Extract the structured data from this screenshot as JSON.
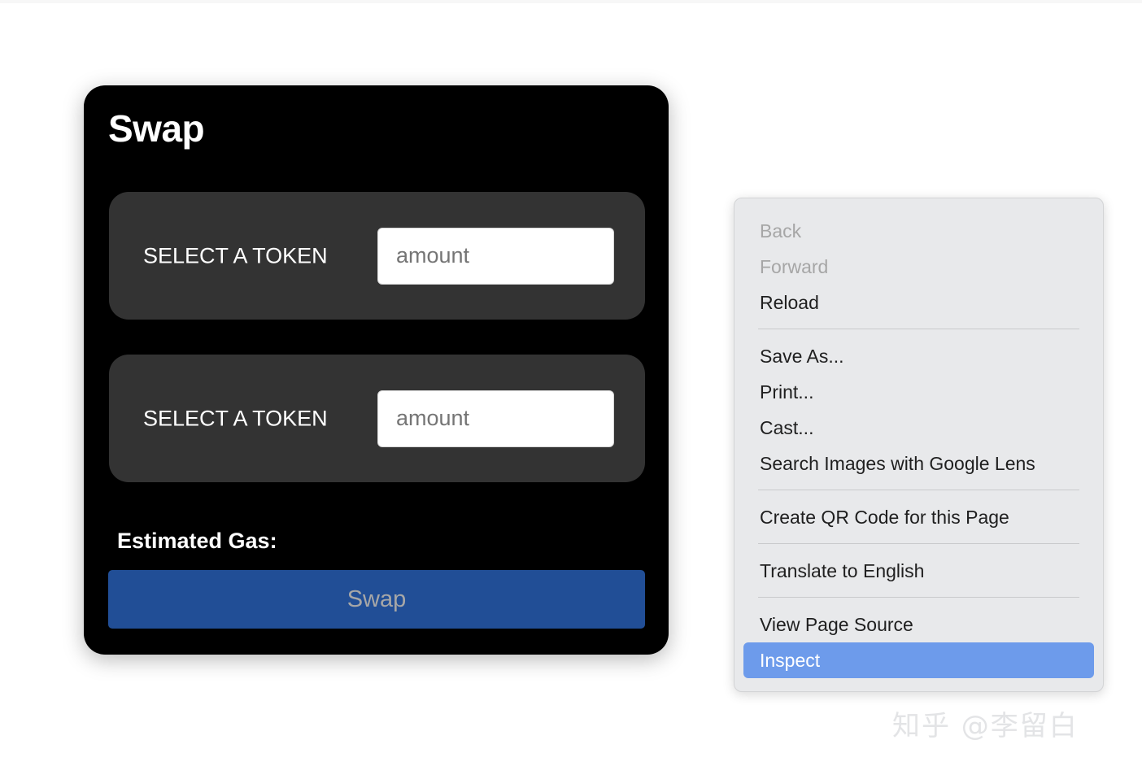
{
  "page": {
    "background_color": "#ffffff",
    "watermark": "知乎 @李留白"
  },
  "swap_card": {
    "title": "Swap",
    "background_color": "#000000",
    "rows": [
      {
        "token_label": "SELECT A TOKEN",
        "amount_placeholder": "amount",
        "amount_value": ""
      },
      {
        "token_label": "SELECT A TOKEN",
        "amount_placeholder": "amount",
        "amount_value": ""
      }
    ],
    "gas_label": "Estimated Gas:",
    "swap_button_label": "Swap",
    "swap_button_color": "#214E96"
  },
  "context_menu": {
    "background_color": "#E8E9EB",
    "highlight_color": "#6D9BEB",
    "items": [
      {
        "label": "Back",
        "state": "disabled"
      },
      {
        "label": "Forward",
        "state": "disabled"
      },
      {
        "label": "Reload",
        "state": "enabled"
      },
      {
        "label": "Save As...",
        "state": "enabled"
      },
      {
        "label": "Print...",
        "state": "enabled"
      },
      {
        "label": "Cast...",
        "state": "enabled"
      },
      {
        "label": "Search Images with Google Lens",
        "state": "enabled"
      },
      {
        "label": "Create QR Code for this Page",
        "state": "enabled"
      },
      {
        "label": "Translate to English",
        "state": "enabled"
      },
      {
        "label": "View Page Source",
        "state": "enabled"
      },
      {
        "label": "Inspect",
        "state": "highlighted"
      }
    ]
  }
}
